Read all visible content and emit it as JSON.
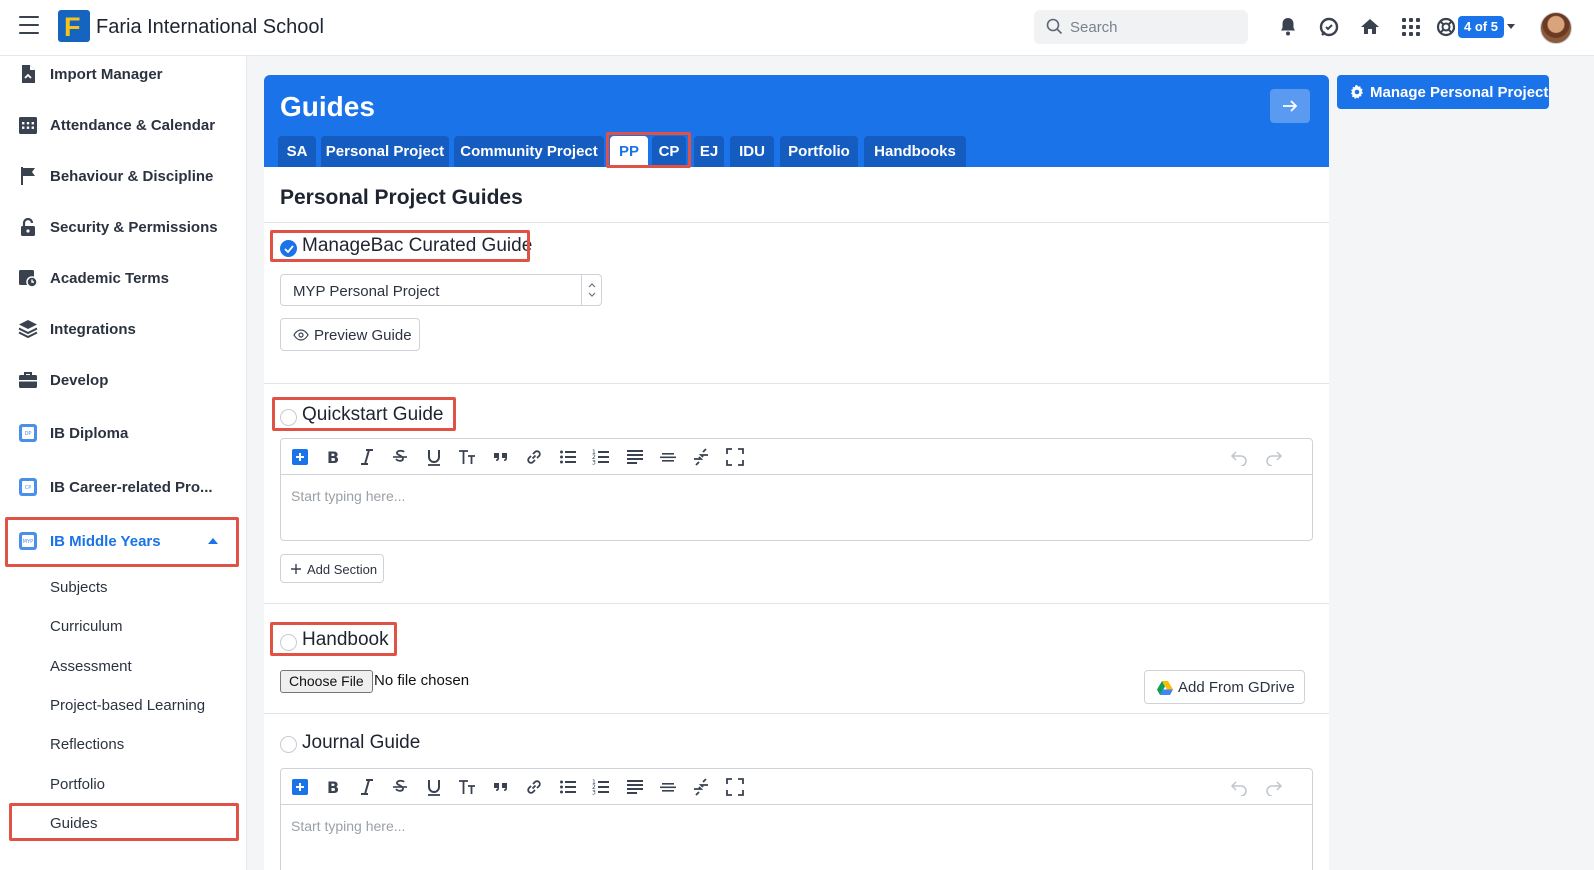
{
  "header": {
    "school_name": "Faria International School",
    "search_placeholder": "Search",
    "badge": "4 of 5"
  },
  "sidebar": {
    "items": [
      {
        "label": "Import Manager",
        "icon": "import-icon"
      },
      {
        "label": "Attendance & Calendar",
        "icon": "calendar-icon"
      },
      {
        "label": "Behaviour & Discipline",
        "icon": "flag-icon"
      },
      {
        "label": "Security & Permissions",
        "icon": "lock-icon"
      },
      {
        "label": "Academic Terms",
        "icon": "calendar-clock-icon"
      },
      {
        "label": "Integrations",
        "icon": "layers-icon"
      },
      {
        "label": "Develop",
        "icon": "briefcase-icon"
      },
      {
        "label": "IB Diploma",
        "icon": "programme-icon"
      },
      {
        "label": "IB Career-related Pro...",
        "icon": "programme-icon"
      },
      {
        "label": "IB Middle Years",
        "icon": "programme-icon",
        "expanded": true
      }
    ],
    "sub_items": [
      "Subjects",
      "Curriculum",
      "Assessment",
      "Project-based Learning",
      "Reflections",
      "Portfolio",
      "Guides"
    ]
  },
  "main": {
    "title": "Guides",
    "tabs": [
      "SA",
      "Personal Project",
      "Community Project",
      "PP",
      "CP",
      "EJ",
      "IDU",
      "Portfolio",
      "Handbooks"
    ],
    "active_tab": "PP",
    "section_title": "Personal Project Guides",
    "curated": {
      "label": "ManageBac Curated Guide",
      "checked": true,
      "select_value": "MYP Personal Project",
      "preview_label": "Preview Guide"
    },
    "quickstart": {
      "label": "Quickstart Guide",
      "checked": false,
      "placeholder": "Start typing here...",
      "add_section_label": "Add Section"
    },
    "handbook": {
      "label": "Handbook",
      "checked": false,
      "choose_file_label": "Choose File",
      "no_file_text": "No file chosen",
      "gdrive_label": "Add From GDrive"
    },
    "journal": {
      "label": "Journal Guide",
      "checked": false,
      "placeholder": "Start typing here..."
    }
  },
  "actions": {
    "manage_label": "Manage Personal Project"
  },
  "colors": {
    "accent": "#1a73e8",
    "tab_bg": "#155cc0",
    "highlight": "#e05245"
  }
}
